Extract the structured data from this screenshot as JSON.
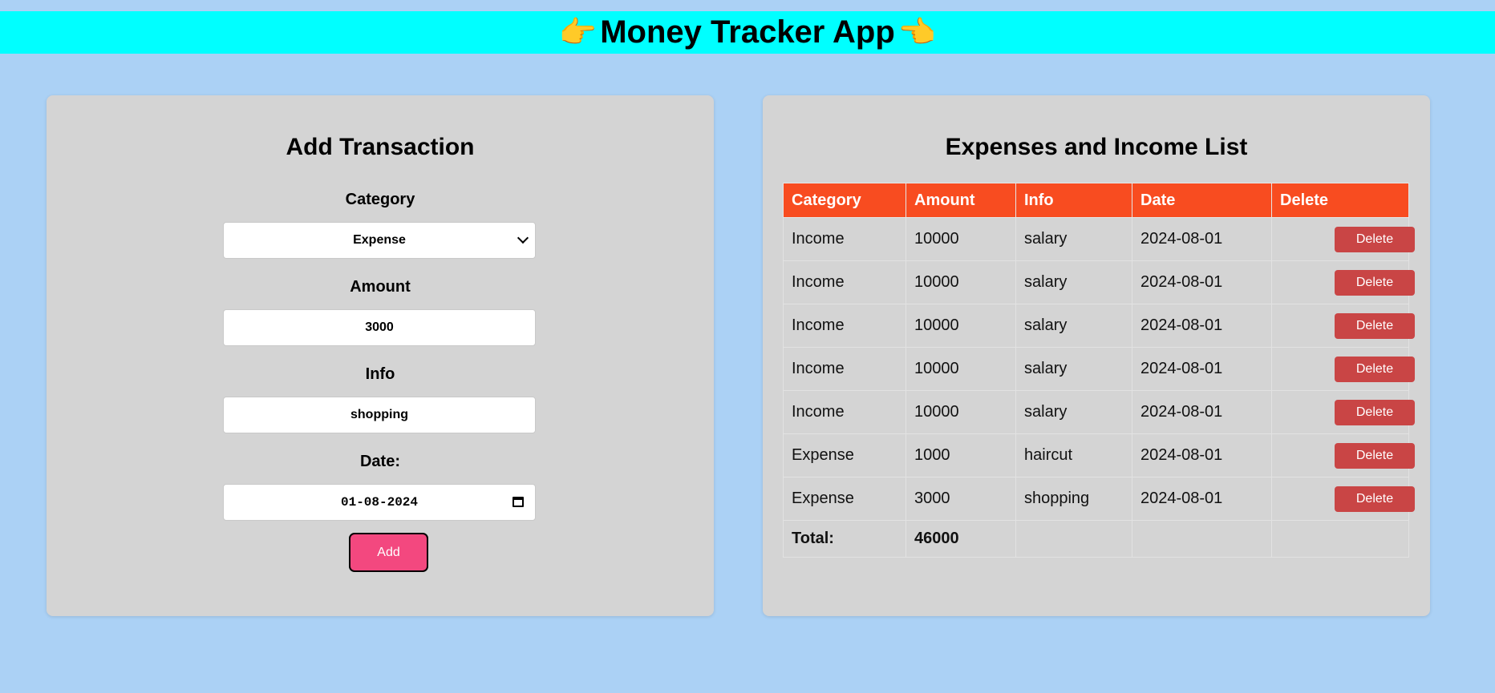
{
  "header": {
    "title": "Money Tracker App",
    "left_icon": "pointing-right-hand-icon",
    "right_icon": "pointing-left-hand-icon"
  },
  "form": {
    "title": "Add Transaction",
    "category_label": "Category",
    "category_value": "Expense",
    "amount_label": "Amount",
    "amount_value": "3000",
    "info_label": "Info",
    "info_value": "shopping",
    "date_label": "Date:",
    "date_value": "01-08-2024",
    "add_label": "Add"
  },
  "list": {
    "title": "Expenses and Income List",
    "columns": [
      "Category",
      "Amount",
      "Info",
      "Date",
      "Delete"
    ],
    "rows": [
      {
        "category": "Income",
        "amount": "10000",
        "info": "salary",
        "date": "2024-08-01",
        "delete_label": "Delete"
      },
      {
        "category": "Income",
        "amount": "10000",
        "info": "salary",
        "date": "2024-08-01",
        "delete_label": "Delete"
      },
      {
        "category": "Income",
        "amount": "10000",
        "info": "salary",
        "date": "2024-08-01",
        "delete_label": "Delete"
      },
      {
        "category": "Income",
        "amount": "10000",
        "info": "salary",
        "date": "2024-08-01",
        "delete_label": "Delete"
      },
      {
        "category": "Income",
        "amount": "10000",
        "info": "salary",
        "date": "2024-08-01",
        "delete_label": "Delete"
      },
      {
        "category": "Expense",
        "amount": "1000",
        "info": "haircut",
        "date": "2024-08-01",
        "delete_label": "Delete"
      },
      {
        "category": "Expense",
        "amount": "3000",
        "info": "shopping",
        "date": "2024-08-01",
        "delete_label": "Delete"
      }
    ],
    "total_label": "Total:",
    "total_value": "46000"
  },
  "colors": {
    "page_bg": "#abd1f5",
    "header_bg": "#00ffff",
    "panel_bg": "#d4d4d4",
    "table_header_bg": "#f84c20",
    "add_button_bg": "#f3487f",
    "delete_button_bg": "#c94545"
  }
}
